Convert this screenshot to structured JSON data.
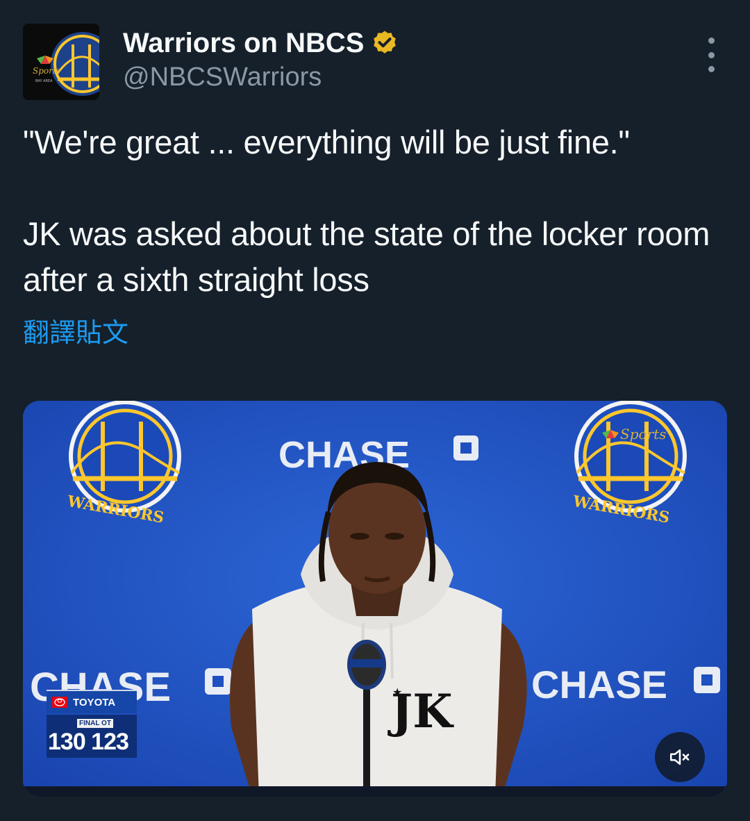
{
  "account": {
    "display_name": "Warriors on NBCS",
    "handle": "@NBCSWarriors",
    "verified": true,
    "avatar_label": "NBC Sports Bay Area"
  },
  "tweet": {
    "text": "\"We're great ... everything will be just fine.\"\n\nJK was asked about the state of the locker room after a sixth straight loss",
    "translate_label": "翻譯貼文"
  },
  "media": {
    "backdrop_sponsor": "CHASE",
    "team_logo_text": "WARRIORS",
    "broadcaster_text": "Sports",
    "scorebug": {
      "sponsor": "TOYOTA",
      "status": "FINAL OT",
      "score": "130 123"
    },
    "jersey_mark": "JK",
    "mute_icon": "speaker-muted-icon"
  },
  "colors": {
    "background": "#15202b",
    "link": "#1d9bf0",
    "secondary_text": "#8b98a5",
    "verified_badge": "#e8b923",
    "backdrop_blue": "#1f4fc0"
  }
}
